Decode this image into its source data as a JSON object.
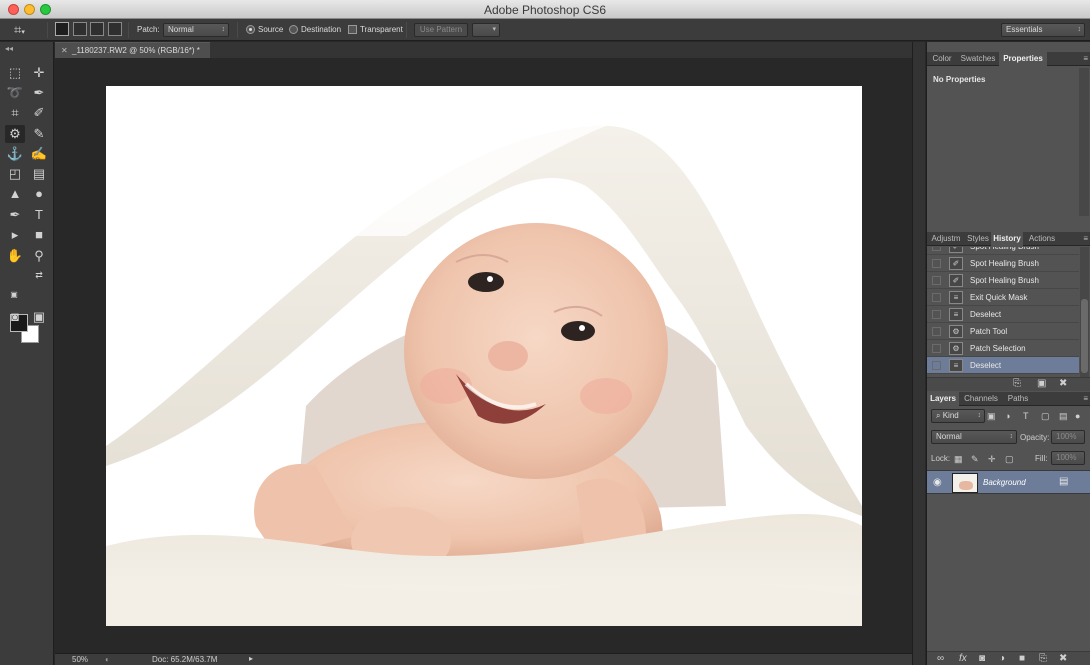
{
  "window": {
    "title": "Adobe Photoshop CS6"
  },
  "options_bar": {
    "patch_label": "Patch:",
    "patch_mode": "Normal",
    "source_label": "Source",
    "destination_label": "Destination",
    "transparent_label": "Transparent",
    "use_pattern_label": "Use Pattern",
    "workspace": "Essentials"
  },
  "document": {
    "tab_title": "_1180237.RW2 @ 50% (RGB/16*) *",
    "zoom": "50%",
    "doc_info": "Doc: 65.2M/63.7M"
  },
  "properties_panel": {
    "tabs": [
      "Color",
      "Swatches",
      "Properties"
    ],
    "active_tab": "Properties",
    "message": "No Properties"
  },
  "history_panel": {
    "tabs": [
      "Adjustm",
      "Styles",
      "History",
      "Actions"
    ],
    "active_tab": "History",
    "partial_item": "Spot Healing Brush",
    "items": [
      {
        "label": "Spot Healing Brush",
        "icon": "brush-icon"
      },
      {
        "label": "Spot Healing Brush",
        "icon": "brush-icon"
      },
      {
        "label": "Exit Quick Mask",
        "icon": "document-icon"
      },
      {
        "label": "Deselect",
        "icon": "document-icon"
      },
      {
        "label": "Patch Tool",
        "icon": "patch-icon"
      },
      {
        "label": "Patch Selection",
        "icon": "patch-icon"
      },
      {
        "label": "Deselect",
        "icon": "document-icon",
        "selected": true
      }
    ]
  },
  "layers_panel": {
    "tabs": [
      "Layers",
      "Channels",
      "Paths"
    ],
    "active_tab": "Layers",
    "filter_kind": "Kind",
    "blend_mode": "Normal",
    "opacity_label": "Opacity:",
    "opacity_value": "100%",
    "lock_label": "Lock:",
    "fill_label": "Fill:",
    "fill_value": "100%",
    "layers": [
      {
        "name": "Background",
        "visible": true,
        "locked": true
      }
    ]
  },
  "colors": {
    "selection_highlight": "#6d7d99",
    "panel_bg": "#535353",
    "chrome_bg": "#3c3c3c"
  }
}
